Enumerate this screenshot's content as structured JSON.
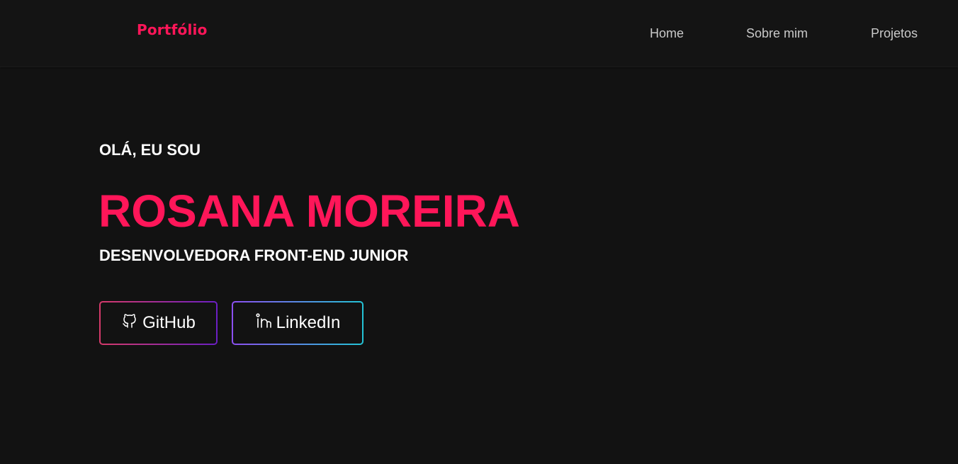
{
  "header": {
    "logo": "Portfólio",
    "nav": {
      "home": "Home",
      "about": "Sobre mim",
      "projects": "Projetos"
    }
  },
  "hero": {
    "greeting": "OLÁ, EU SOU",
    "name": "ROSANA MOREIRA",
    "role": "DESENVOLVEDORA FRONT-END JUNIOR"
  },
  "buttons": {
    "github": {
      "label": "GitHub",
      "icon": "github-icon"
    },
    "linkedin": {
      "label": "LinkedIn",
      "icon": "linkedin-icon"
    }
  },
  "colors": {
    "background": "#121212",
    "accent": "#ff1659",
    "nav_text": "#c9c9c9",
    "github_gradient": [
      "#d63a6a",
      "#6b1fc4"
    ],
    "linkedin_gradient": [
      "#8c4ff0",
      "#23c4d6"
    ]
  }
}
